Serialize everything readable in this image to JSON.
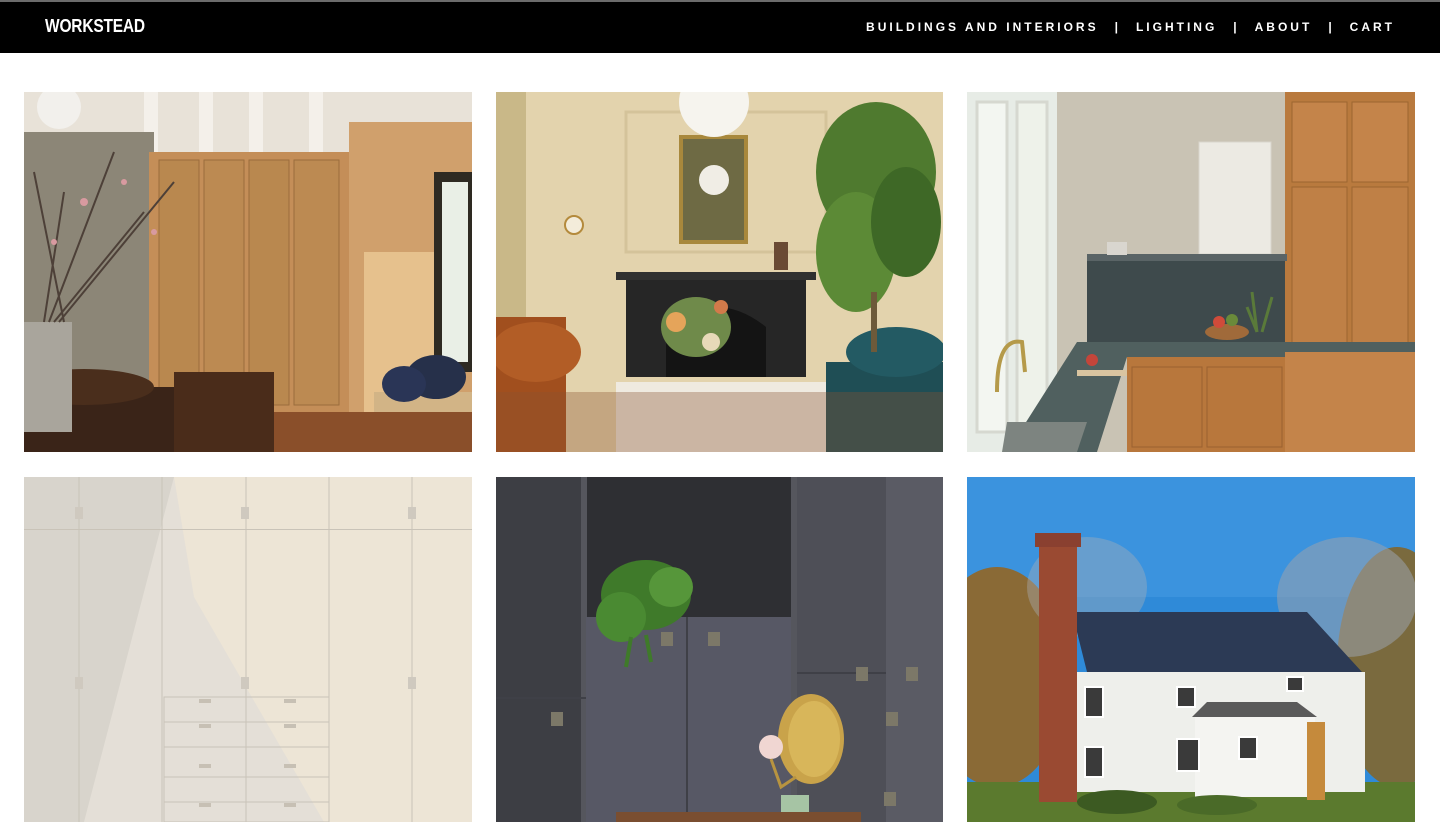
{
  "brand": {
    "logo": "WORKSTEAD"
  },
  "nav": {
    "items": [
      {
        "label": "BUILDINGS AND INTERIORS"
      },
      {
        "label": "LIGHTING"
      },
      {
        "label": "ABOUT"
      },
      {
        "label": "CART"
      }
    ],
    "separator": "|"
  },
  "colors": {
    "header_bg": "#000000",
    "header_text": "#ffffff",
    "page_bg": "#ffffff"
  },
  "gallery": {
    "tiles": [
      {
        "name": "wood-cabinetry-room-photo"
      },
      {
        "name": "living-room-fireplace-photo"
      },
      {
        "name": "wood-kitchen-photo"
      },
      {
        "name": "white-cabinets-photo"
      },
      {
        "name": "metal-wall-lamp-photo"
      },
      {
        "name": "farmhouse-exterior-photo"
      }
    ]
  }
}
